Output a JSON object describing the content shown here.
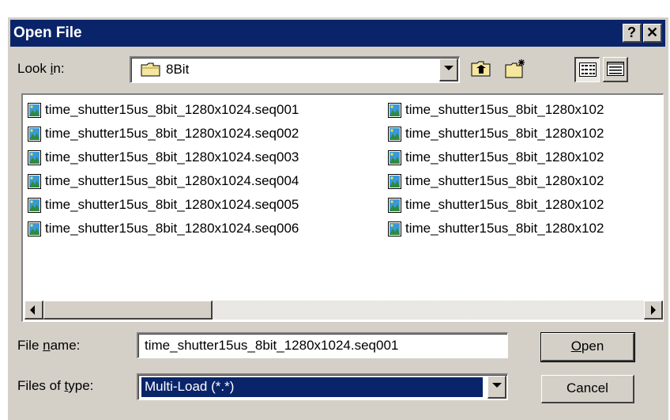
{
  "window": {
    "title": "Open File",
    "help_label": "?",
    "close_label": "✕"
  },
  "look_in": {
    "label_prefix": "Look ",
    "label_accel": "i",
    "label_suffix": "n:",
    "value": "8Bit"
  },
  "toolbar": {
    "up_icon": "folder-up-icon",
    "new_folder_icon": "new-folder-icon",
    "list_view_icon": "list-view-icon",
    "details_view_icon": "details-view-icon"
  },
  "files": {
    "column1": [
      "time_shutter15us_8bit_1280x1024.seq001",
      "time_shutter15us_8bit_1280x1024.seq002",
      "time_shutter15us_8bit_1280x1024.seq003",
      "time_shutter15us_8bit_1280x1024.seq004",
      "time_shutter15us_8bit_1280x1024.seq005",
      "time_shutter15us_8bit_1280x1024.seq006"
    ],
    "column2": [
      "time_shutter15us_8bit_1280x102",
      "time_shutter15us_8bit_1280x102",
      "time_shutter15us_8bit_1280x102",
      "time_shutter15us_8bit_1280x102",
      "time_shutter15us_8bit_1280x102",
      "time_shutter15us_8bit_1280x102"
    ]
  },
  "file_name": {
    "label_prefix": "File ",
    "label_accel": "n",
    "label_suffix": "ame:",
    "value": "time_shutter15us_8bit_1280x1024.seq001"
  },
  "file_type": {
    "label_prefix": "Files of ",
    "label_accel": "t",
    "label_suffix": "ype:",
    "value": "Multi-Load (*.*)"
  },
  "buttons": {
    "open_accel": "O",
    "open_rest": "pen",
    "cancel": "Cancel"
  },
  "colors": {
    "title_bar": "#0a246a",
    "face": "#d4d0c8",
    "selection": "#0a246a"
  }
}
